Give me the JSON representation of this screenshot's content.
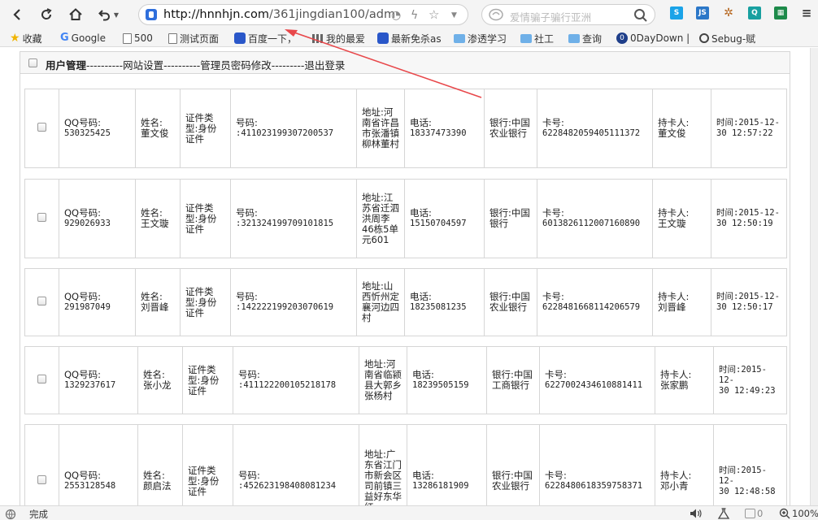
{
  "browser": {
    "url_host": "http://hnnhjn.com",
    "url_path": "/361jingdian100/adm",
    "search_placeholder": "爱情骗子骗行亚洲"
  },
  "bookmarks": [
    {
      "label": "收藏",
      "icon": "star-icon"
    },
    {
      "label": "Google",
      "icon": "google-icon"
    },
    {
      "label": "500",
      "icon": "page-icon"
    },
    {
      "label": "测试页面",
      "icon": "page-icon"
    },
    {
      "label": "百度一下，",
      "icon": "baidu-icon"
    },
    {
      "label": "我的最爱",
      "icon": "grid-icon"
    },
    {
      "label": "最新免杀as",
      "icon": "baidu-icon"
    },
    {
      "label": "渗透学习",
      "icon": "folder-icon"
    },
    {
      "label": "社工",
      "icon": "folder-icon"
    },
    {
      "label": "查询",
      "icon": "folder-icon"
    },
    {
      "label": "0DayDown |",
      "icon": "zero-icon"
    },
    {
      "label": "Sebug-赋",
      "icon": "power-icon"
    }
  ],
  "menu": {
    "user_mgmt": "用户管理",
    "sep1": "----------",
    "site_settings": "网站设置",
    "sep2": "----------",
    "admin_password": "管理员密码修改",
    "sep3": "---------",
    "logout": "退出登录"
  },
  "records": [
    {
      "qq_label": "QQ号码:",
      "qq": "530325425",
      "name_label": "姓名:",
      "name": "董文俊",
      "id_type": "证件类型:身份证件",
      "number_label": "号码:",
      "number": ":411023199307200537",
      "address": "地址:河南省许昌市张潘镇柳林董村",
      "phone_label": "电话:",
      "phone": "18337473390",
      "bank": "银行:中国农业银行",
      "card_label": "卡号:",
      "card": "6228482059405111372",
      "holder_label": "持卡人:",
      "holder": "董文俊",
      "time_label": "时间:2015-12-",
      "time": "30 12:57:22"
    },
    {
      "qq_label": "QQ号码:",
      "qq": "929026933",
      "name_label": "姓名:",
      "name": "王文璇",
      "id_type": "证件类型:身份证件",
      "number_label": "号码:",
      "number": ":321324199709101815",
      "address": "地址:江苏省迁泗洪周李46栋5单元601",
      "phone_label": "电话:",
      "phone": "15150704597",
      "bank": "银行:中国银行",
      "card_label": "卡号:",
      "card": "6013826112007160890",
      "holder_label": "持卡人:",
      "holder": "王文璇",
      "time_label": "时间:2015-12-",
      "time": "30 12:50:19"
    },
    {
      "qq_label": "QQ号码:",
      "qq": "291987049",
      "name_label": "姓名:",
      "name": "刘晋峰",
      "id_type": "证件类型:身份证件",
      "number_label": "号码:",
      "number": ":142222199203070619",
      "address": "地址:山西忻州定襄河边四村",
      "phone_label": "电话:",
      "phone": "18235081235",
      "bank": "银行:中国农业银行",
      "card_label": "卡号:",
      "card": "6228481668114206579",
      "holder_label": "持卡人:",
      "holder": "刘晋峰",
      "time_label": "时间:2015-12-",
      "time": "30 12:50:17"
    },
    {
      "qq_label": "QQ号码:",
      "qq": "1329237617",
      "name_label": "姓名:",
      "name": "张小龙",
      "id_type": "证件类型:身份证件",
      "number_label": "号码:",
      "number": ":411122200105218178",
      "address": "地址:河南省临颍县大郭乡张杨村",
      "phone_label": "电话:",
      "phone": "18239505159",
      "bank": "银行:中国工商银行",
      "card_label": "卡号:",
      "card": "6227002434610881411",
      "holder_label": "持卡人:",
      "holder": "张家鹏",
      "time_label": "时间:2015-12-",
      "time": "30 12:49:23"
    },
    {
      "qq_label": "QQ号码:",
      "qq": "2553128548",
      "name_label": "姓名:",
      "name": "颜启法",
      "id_type": "证件类型:身份证件",
      "number_label": "号码:",
      "number": ":452623198408081234",
      "address": "地址:广东省江门市新会区司前镇三益好东华红",
      "phone_label": "电话:",
      "phone": "13286181909",
      "bank": "银行:中国农业银行",
      "card_label": "卡号:",
      "card": "6228480618359758371",
      "holder_label": "持卡人:",
      "holder": "邓小青",
      "time_label": "时间:2015-12-",
      "time": "30 12:48:58"
    }
  ],
  "status": {
    "left": "完成",
    "count": "0",
    "zoom": "100%"
  },
  "colors": {
    "annotation_arrow": "#e8474a",
    "link_blue": "#2f6fdc"
  }
}
